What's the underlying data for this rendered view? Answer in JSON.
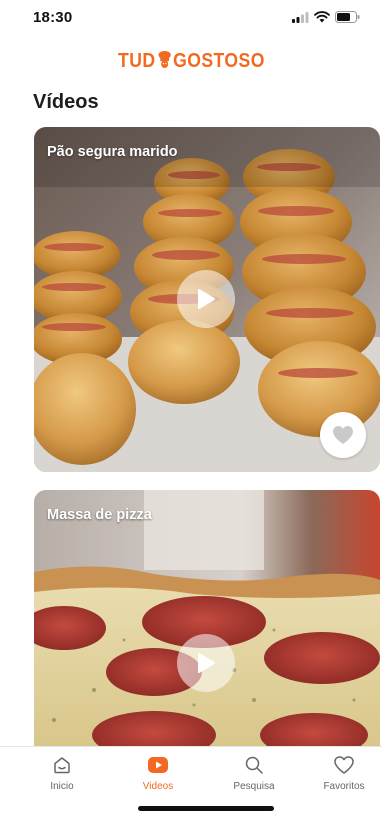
{
  "status_bar": {
    "time": "18:30"
  },
  "header": {
    "logo_text_left": "TUD",
    "logo_text_right": "GOSTOSO",
    "title": "Vídeos"
  },
  "videos": [
    {
      "title": "Pão segura marido"
    },
    {
      "title": "Massa de pizza"
    }
  ],
  "tab_bar": {
    "tabs": [
      {
        "label": "Inicio",
        "icon": "home-icon"
      },
      {
        "label": "Videos",
        "icon": "video-icon",
        "active": true
      },
      {
        "label": "Pesquisa",
        "icon": "search-icon"
      },
      {
        "label": "Favoritos",
        "icon": "heart-icon"
      }
    ]
  },
  "colors": {
    "accent": "#f26a21",
    "inactive": "#666666"
  }
}
